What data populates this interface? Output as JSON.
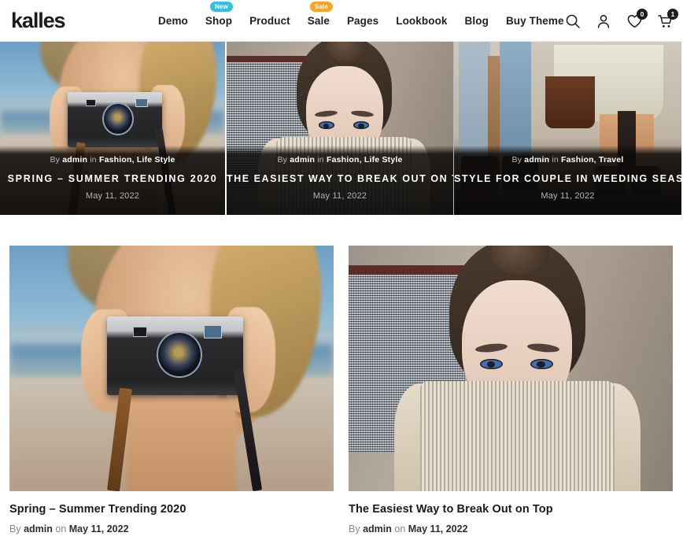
{
  "header": {
    "logo": "kalles",
    "nav": [
      {
        "label": "Demo",
        "badge": null
      },
      {
        "label": "Shop",
        "badge": "New",
        "badge_type": "new",
        "badge_color": "#32bfe0"
      },
      {
        "label": "Product",
        "badge": null
      },
      {
        "label": "Sale",
        "badge": "Sale",
        "badge_type": "sale",
        "badge_color": "#f5a623"
      },
      {
        "label": "Pages",
        "badge": null
      },
      {
        "label": "Lookbook",
        "badge": null
      },
      {
        "label": "Blog",
        "badge": null
      },
      {
        "label": "Buy Theme",
        "badge": null
      }
    ],
    "actions": {
      "search": "search-icon",
      "account": "user-icon",
      "wishlist": "heart-icon",
      "wishlist_count": "0",
      "cart": "cart-icon",
      "cart_count": "1"
    }
  },
  "hero": {
    "slides": [
      {
        "by_label": "By",
        "author": "admin",
        "in_label": "in",
        "categories": "Fashion, Life Style",
        "title": "SPRING – SUMMER TRENDING 2020",
        "date": "May 11, 2022"
      },
      {
        "by_label": "By",
        "author": "admin",
        "in_label": "in",
        "categories": "Fashion, Life Style",
        "title": "THE EASIEST WAY TO BREAK OUT ON TOP",
        "date": "May 11, 2022"
      },
      {
        "by_label": "By",
        "author": "admin",
        "in_label": "in",
        "categories": "Fashion, Travel",
        "title": "STYLE FOR COUPLE IN WEEDING SEASON",
        "date": "May 11, 2022"
      }
    ]
  },
  "posts": [
    {
      "title": "Spring – Summer Trending 2020",
      "by_label": "By",
      "author": "admin",
      "on_label": "on",
      "date": "May 11, 2022"
    },
    {
      "title": "The Easiest Way to Break Out on Top",
      "by_label": "By",
      "author": "admin",
      "on_label": "on",
      "date": "May 11, 2022"
    }
  ],
  "theme": {
    "text_color": "#1b1b1b",
    "muted_color": "#8a8a8a",
    "background": "#ffffff"
  }
}
